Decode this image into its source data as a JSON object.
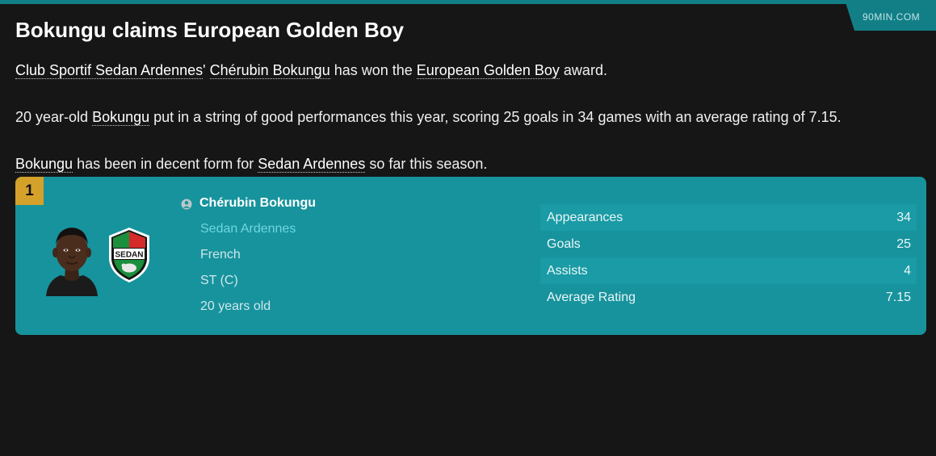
{
  "header": {
    "source": "90MIN.COM",
    "headline": "Bokungu claims European Golden Boy"
  },
  "article": {
    "p1": {
      "club_link": "Club Sportif Sedan Ardennes",
      "sep1": "' ",
      "player_link": "Chérubin Bokungu",
      "text1": " has won the ",
      "award_link": "European Golden Boy",
      "text2": " award."
    },
    "p2": {
      "text1": "20 year-old ",
      "player_link": "Bokungu",
      "text2": " put in a string of good performances this year, scoring 25 goals in 34 games with an average rating of 7.15."
    },
    "p3": {
      "player_link": "Bokungu",
      "text1": " has been in decent form for ",
      "club_link": "Sedan Ardennes",
      "text2": " so far this season."
    }
  },
  "card": {
    "rank": "1",
    "player_name": "Chérubin Bokungu",
    "club": "Sedan Ardennes",
    "nationality": "French",
    "position": "ST (C)",
    "age": "20 years old",
    "badge_text": "SEDAN",
    "stats": [
      {
        "label": "Appearances",
        "value": "34"
      },
      {
        "label": "Goals",
        "value": "25"
      },
      {
        "label": "Assists",
        "value": "4"
      },
      {
        "label": "Average Rating",
        "value": "7.15"
      }
    ]
  },
  "colors": {
    "accent": "#127f87",
    "card": "#17939d",
    "rank_badge": "#d4a12a",
    "club_text": "#6fd6df",
    "background": "#161616"
  },
  "icons": {
    "person": "person-icon",
    "player_photo": "player-photo",
    "club_badge": "club-badge"
  }
}
